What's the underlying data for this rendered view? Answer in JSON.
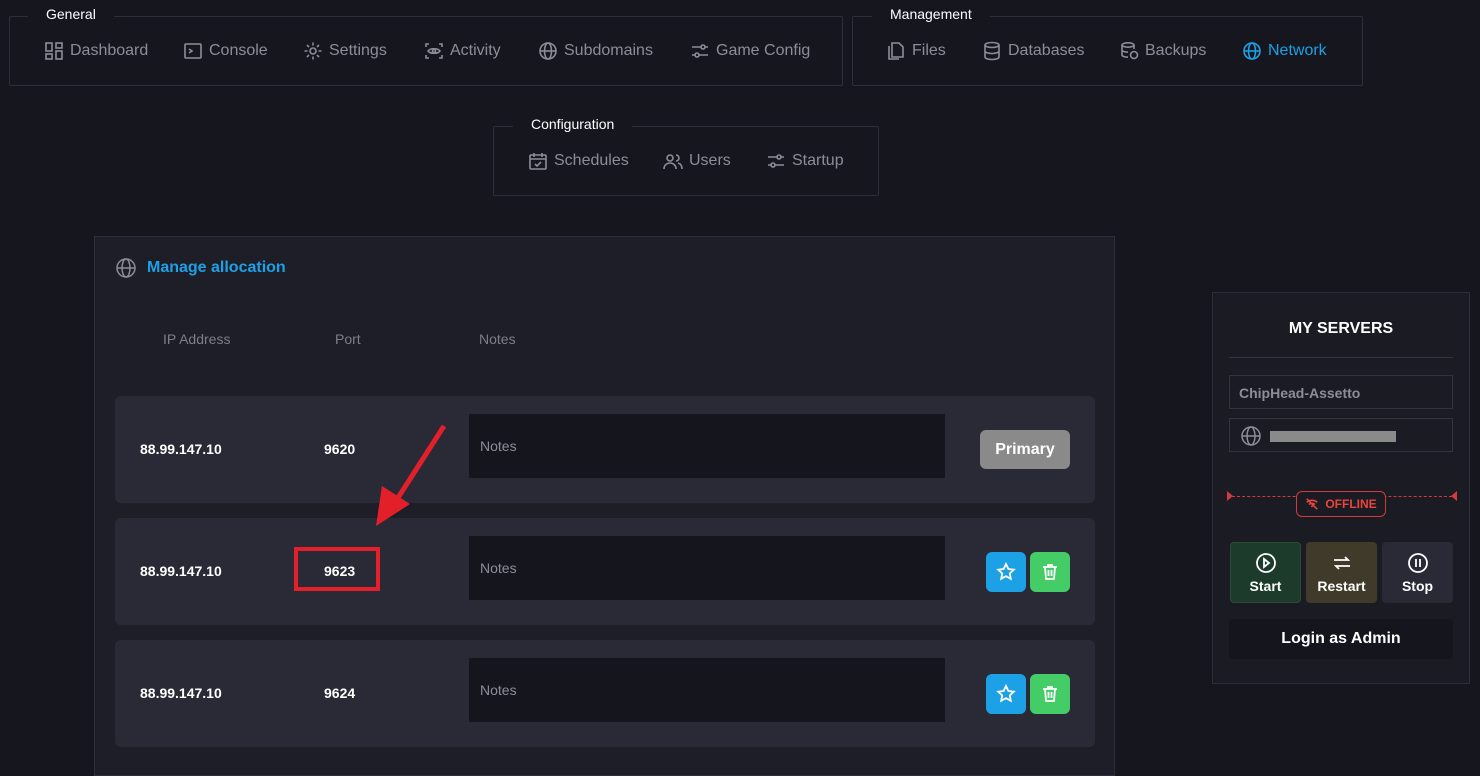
{
  "nav": {
    "general": {
      "title": "General",
      "items": [
        "Dashboard",
        "Console",
        "Settings",
        "Activity",
        "Subdomains",
        "Game Config"
      ]
    },
    "management": {
      "title": "Management",
      "items": [
        "Files",
        "Databases",
        "Backups",
        "Network"
      ],
      "active": "Network"
    },
    "configuration": {
      "title": "Configuration",
      "items": [
        "Schedules",
        "Users",
        "Startup"
      ]
    }
  },
  "allocation": {
    "title": "Manage allocation",
    "columns": [
      "IP Address",
      "Port",
      "Notes"
    ],
    "notes_placeholder": "Notes",
    "primary_label": "Primary",
    "rows": [
      {
        "ip": "88.99.147.10",
        "port": "9620",
        "primary": true
      },
      {
        "ip": "88.99.147.10",
        "port": "9623",
        "primary": false
      },
      {
        "ip": "88.99.147.10",
        "port": "9624",
        "primary": false
      }
    ]
  },
  "servers": {
    "title": "MY SERVERS",
    "name": "ChipHead-Assetto",
    "status": "OFFLINE",
    "controls": {
      "start": "Start",
      "restart": "Restart",
      "stop": "Stop"
    },
    "login_admin": "Login as Admin"
  },
  "colors": {
    "accent": "#1da1e6",
    "background": "#16161f",
    "panel": "#1e1e28",
    "row": "#2a2a37",
    "trash": "#44cc66",
    "danger": "#e3202a"
  }
}
